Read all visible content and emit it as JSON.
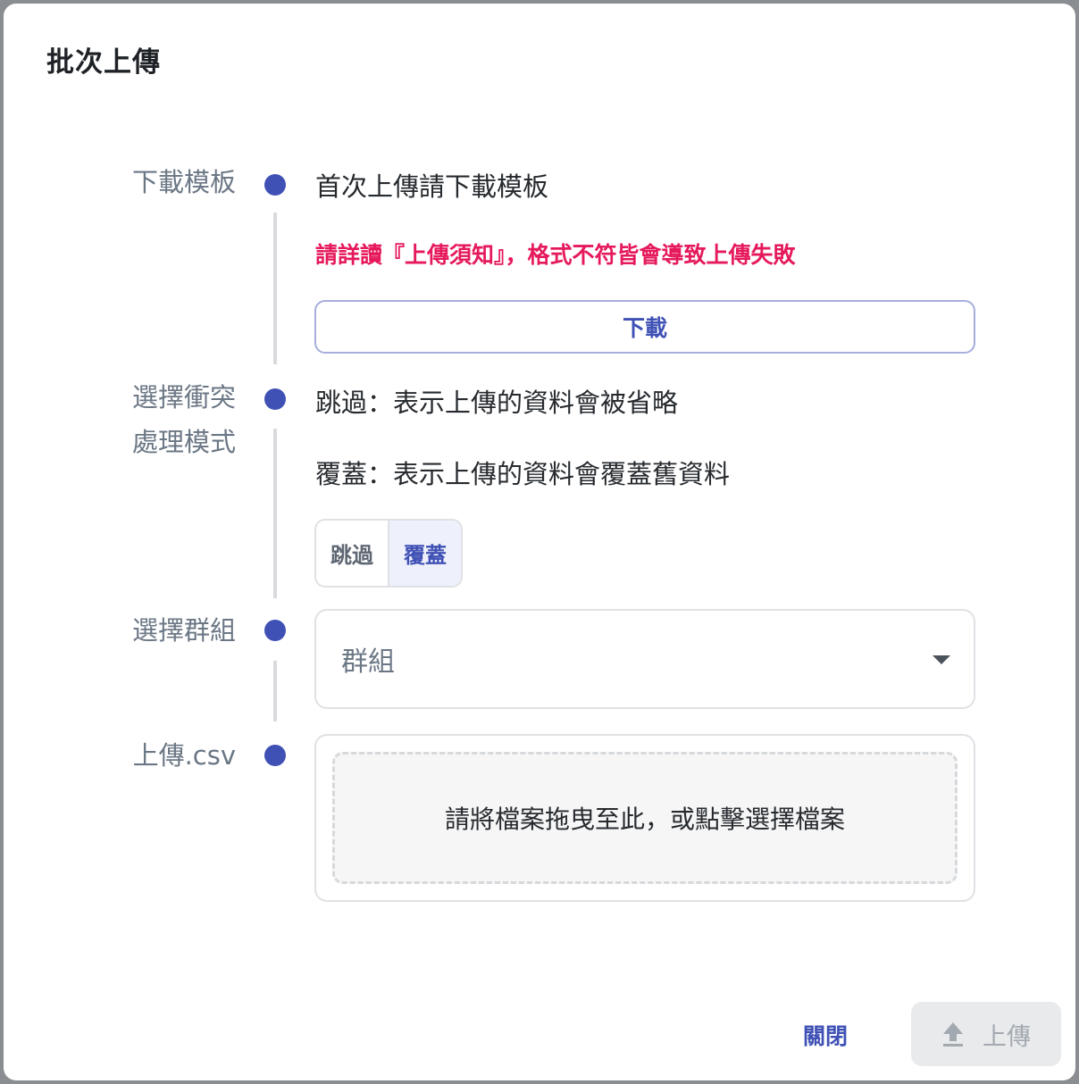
{
  "dialog": {
    "title": "批次上傳",
    "steps": [
      {
        "label": "下載模板"
      },
      {
        "label_line1": "選擇衝突",
        "label_line2": "處理模式"
      },
      {
        "label": "選擇群組"
      },
      {
        "label": "上傳.csv"
      }
    ],
    "download": {
      "hint": "首次上傳請下載模板",
      "warning": "請詳讀『上傳須知』，格式不符皆會導致上傳失敗",
      "button_label": "下載"
    },
    "conflict": {
      "skip_desc": "跳過：表示上傳的資料會被省略",
      "overwrite_desc": "覆蓋：表示上傳的資料會覆蓋舊資料",
      "options": [
        "跳過",
        "覆蓋"
      ],
      "selected": "覆蓋"
    },
    "group": {
      "placeholder": "群組"
    },
    "file": {
      "dropzone_text": "請將檔案拖曳至此，或點擊選擇檔案"
    },
    "footer": {
      "close_label": "關閉",
      "upload_label": "上傳"
    }
  },
  "colors": {
    "accent": "#3f51b5",
    "warning": "#e5195b",
    "disabled_bg": "#e8eaec"
  }
}
